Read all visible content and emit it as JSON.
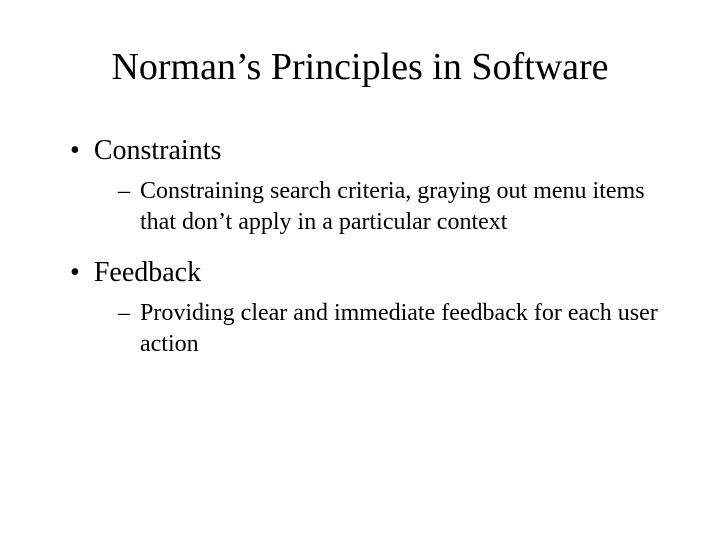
{
  "title": "Norman’s Principles in Software",
  "items": [
    {
      "label": "Constraints",
      "sub": "Constraining search criteria, graying out menu items that don’t apply in a particular context"
    },
    {
      "label": "Feedback",
      "sub": "Providing clear and immediate feedback for each user action"
    }
  ]
}
